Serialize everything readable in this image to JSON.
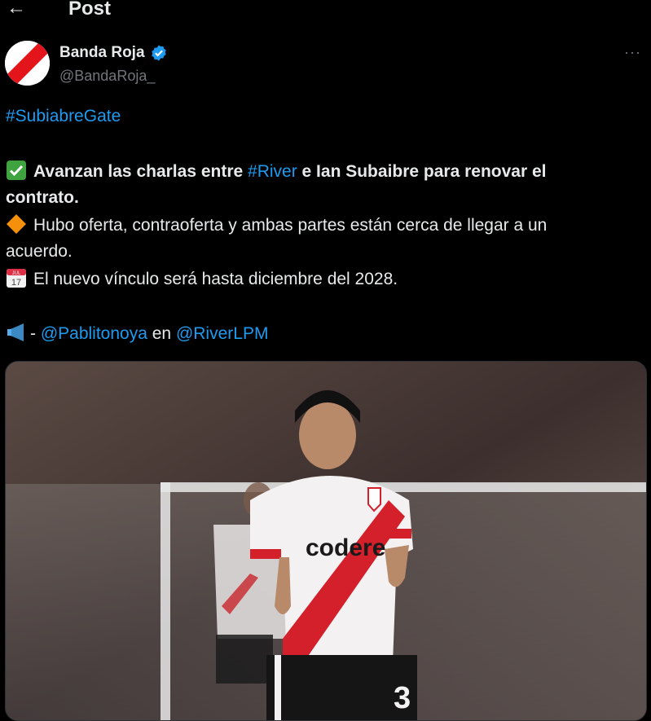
{
  "header": {
    "back_icon": "arrow-left-icon",
    "title": "Post"
  },
  "author": {
    "name": "Banda Roja",
    "handle": "@BandaRoja_",
    "verified": true,
    "avatar_icon": "river-sash-avatar"
  },
  "more_label": "···",
  "post": {
    "hashtag_line": "#SubiabreGate",
    "line1_emoji": "check-mark-button-icon",
    "line1_a": "Avanzan las charlas entre ",
    "line1_link": "#River",
    "line1_b": " e Ian Subaibre para renovar el",
    "line2": "contrato.",
    "line3_emoji": "orange-diamond-icon",
    "line3": "Hubo oferta, contraoferta y ambas partes están cerca de llegar a un",
    "line4": "acuerdo.",
    "line5_emoji": "calendar-icon",
    "line5": "El nuevo vínculo será hasta diciembre del 2028.",
    "line6_emoji": "megaphone-icon",
    "line6_dash": "- ",
    "line6_link1": "@Pablitonoya",
    "line6_mid": " en ",
    "line6_link2": "@RiverLPM"
  },
  "calendar": {
    "month": "JUL",
    "day": "17"
  },
  "photo": {
    "jersey_text": "codere",
    "number": "3"
  },
  "colors": {
    "link": "#1d9bf0",
    "verified": "#1d9bf0",
    "background": "#000000"
  }
}
